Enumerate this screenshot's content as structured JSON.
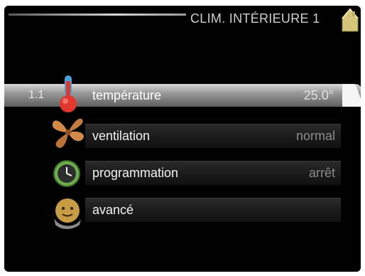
{
  "header": {
    "title": "CLIM. INTÉRIEURE 1",
    "home_icon": "home-icon"
  },
  "menu": {
    "items": [
      {
        "number": "1.1",
        "label": "température",
        "value": "25.0°",
        "icon": "thermometer-icon",
        "selected": true
      },
      {
        "label": "ventilation",
        "value": "normal",
        "icon": "fan-icon",
        "selected": false
      },
      {
        "label": "programmation",
        "value": "arrêt",
        "icon": "clock-icon",
        "selected": false
      },
      {
        "label": "avancé",
        "value": "",
        "icon": "technician-icon",
        "selected": false
      }
    ]
  },
  "colors": {
    "background": "#000000",
    "selected_row_top": "#d8d8d8",
    "selected_row_bottom": "#5f5f5f",
    "home_icon": "#d4c57a",
    "thermometer": "#e0372f",
    "fan": "#d2894a",
    "clock": "#6fae4e",
    "technician": "#c79c45"
  }
}
